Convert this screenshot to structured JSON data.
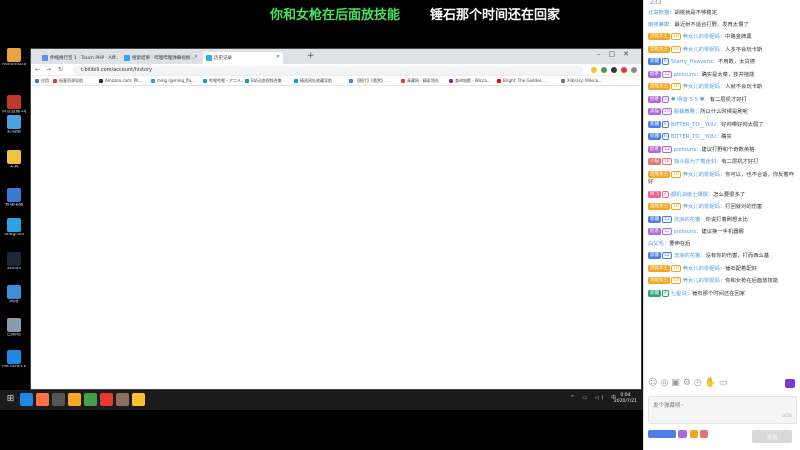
{
  "overlay": {
    "banner_left": "你和女枪在后面放技能",
    "banner_right": "锤石那个时间还在回家"
  },
  "desktop": {
    "icons": [
      {
        "label": "Administra...",
        "color": "#e6a23c"
      },
      {
        "label": "抖音直播.zip",
        "color": "#c0392b"
      },
      {
        "label": "此电脑",
        "color": "#4aa3df"
      },
      {
        "label": "工具",
        "color": "#f0c040"
      },
      {
        "label": "管理电脑",
        "color": "#3b78d1"
      },
      {
        "label": "Telegram",
        "color": "#2aa3e0"
      },
      {
        "label": "Steam",
        "color": "#1b2838"
      },
      {
        "label": "网络",
        "color": "#3f8ed8"
      },
      {
        "label": "回收站",
        "color": "#8a9bb0"
      },
      {
        "label": "Microsoft Edge",
        "color": "#1e88e5"
      }
    ]
  },
  "browser": {
    "tabs": [
      {
        "label": "伸缩换行签 1 · Touch PHP · Ast...",
        "active": false,
        "color": "#5b8def"
      },
      {
        "label": "搜索结果 · 哔哩哔哩弹幕视频...",
        "active": false,
        "color": "#3ba0e6"
      },
      {
        "label": "历史记录",
        "active": true,
        "color": "#2cb0e5"
      }
    ],
    "url": "t.bilibili.com/account/history",
    "bookmarks": [
      {
        "label": "应用",
        "color": "#3c78d8"
      },
      {
        "label": "极客资源导航",
        "color": "#e53935"
      },
      {
        "label": "Amazon.com: Ph...",
        "color": "#333333"
      },
      {
        "label": "ming (@ming_fla...",
        "color": "#1da1f2"
      },
      {
        "label": "哔哩哔哩 - アニメ...",
        "color": "#00a1d6"
      },
      {
        "label": "B站动态视频合集",
        "color": "#00a1d6"
      },
      {
        "label": "精选网址收藏导航",
        "color": "#00a1d6"
      },
      {
        "label": "【图片】《悬赏》...",
        "color": "#3385ff"
      },
      {
        "label": "青藏网 · 精彩领先",
        "color": "#e53935"
      },
      {
        "label": "查询电影 · Wicca...",
        "color": "#8e24aa"
      },
      {
        "label": "Bright: The Goddes...",
        "color": "#ff0000"
      },
      {
        "label": "Xlibrary: Wileco...",
        "color": "#777777"
      }
    ]
  },
  "taskbar": {
    "apps": [
      "#1e88e5",
      "#ff7043",
      "#555555",
      "#f9a825",
      "#43a047",
      "#e53935",
      "#8d6e63",
      "#fbc02d"
    ],
    "tray": "^ ▭ ◁) 中",
    "time": "0:04",
    "date": "2020/7/21"
  },
  "chat": {
    "count": "233",
    "messages": [
      {
        "badge": "",
        "badge_color": "",
        "level": "",
        "name": "北岛熊猫",
        "text": "胡桃就是不够稳定"
      },
      {
        "badge": "",
        "badge_color": "",
        "level": "",
        "name": "南夜兼康",
        "text": "最近射不适合打野，发育太慢了"
      },
      {
        "badge": "混能女王",
        "badge_color": "#f5a623",
        "level": "19",
        "name": "养女儿的零妮妈",
        "text": "中路金牌黑"
      },
      {
        "badge": "混能女王",
        "badge_color": "#f5a623",
        "level": "19",
        "name": "养女儿的零妮妈",
        "text": "人多不会玩卡斯"
      },
      {
        "badge": "新疆",
        "badge_color": "#4a7ee8",
        "level": "6",
        "name": "Starry_Heavens",
        "text": "不用数，太贷德"
      },
      {
        "badge": "奶茶",
        "badge_color": "#b36ad9",
        "level": "12",
        "name": "pietsuns",
        "text": "确实是太菜，技并拖能"
      },
      {
        "badge": "混能女王",
        "badge_color": "#f5a623",
        "level": "19",
        "name": "养女儿的零妮妈",
        "text": "人就不会玩卡斯"
      },
      {
        "badge": "奶茶",
        "badge_color": "#b36ad9",
        "level": "3",
        "name": "♥ 明音 5 5 ♥",
        "text": "有二层机才好打"
      },
      {
        "badge": "美猫",
        "badge_color": "#b36ad9",
        "level": "19",
        "name": "顾暴教雅",
        "text": "所以什么时候是刷呢"
      },
      {
        "badge": "新疆",
        "badge_color": "#4a7ee8",
        "level": "6",
        "name": "BITTER_TO__YOU",
        "text": "好帅带好帅太弱了"
      },
      {
        "badge": "新疆",
        "badge_color": "#4a7ee8",
        "level": "6",
        "name": "BITTER_TO__YOU",
        "text": "确实"
      },
      {
        "badge": "奶茶",
        "badge_color": "#b36ad9",
        "level": "12",
        "name": "pietsuns",
        "text": "建议打野和个奇数英格"
      },
      {
        "badge": "小猫",
        "badge_color": "#e57373",
        "level": "18",
        "name": "独斗振为了着迷封",
        "text": "有二层机才好打"
      },
      {
        "badge": "混能女王",
        "badge_color": "#f5a623",
        "level": "19",
        "name": "养女儿的零妮妈",
        "text": "你可以，也不合适，你反着咋好"
      },
      {
        "badge": "阿飞",
        "badge_color": "#f06292",
        "level": "4",
        "name": "都机油级士爆爆",
        "text": "怎么要很多了"
      },
      {
        "badge": "混能女王",
        "badge_color": "#f5a623",
        "level": "19",
        "name": "养女儿的零妮妈",
        "text": "打回就对的伤害"
      },
      {
        "badge": "新疆",
        "badge_color": "#4a7ee8",
        "level": "12",
        "name": "流浪的花猫",
        "text": "你说打着刷想太比"
      },
      {
        "badge": "奶茶",
        "badge_color": "#b36ad9",
        "level": "12",
        "name": "pietsuns",
        "text": "建议换一手机器娜"
      },
      {
        "badge": "",
        "badge_color": "",
        "level": "",
        "name": "白父毛",
        "text": "要伸在后"
      },
      {
        "badge": "新疆",
        "badge_color": "#4a7ee8",
        "level": "12",
        "name": "流浪的花猫",
        "text": "没有你的伤害，打而西么基"
      },
      {
        "badge": "混能女王",
        "badge_color": "#f5a623",
        "level": "19",
        "name": "养女儿的零妮妈",
        "text": "锤石配着配好"
      },
      {
        "badge": "混能女王",
        "badge_color": "#f5a623",
        "level": "19",
        "name": "养女儿的零妮妈",
        "text": "你和女枪在后面放技能"
      },
      {
        "badge": "新疆",
        "badge_color": "#2fa66b",
        "level": "4",
        "name": "七星说",
        "text": "锤石那个时间还在回家"
      }
    ],
    "input_placeholder": "发个弹幕呗~",
    "counter": "0/20",
    "footer_badges": [
      "#4a7ee8",
      "#b36ad9",
      "#f5a623",
      "#e57373"
    ],
    "send_label": "发送"
  }
}
